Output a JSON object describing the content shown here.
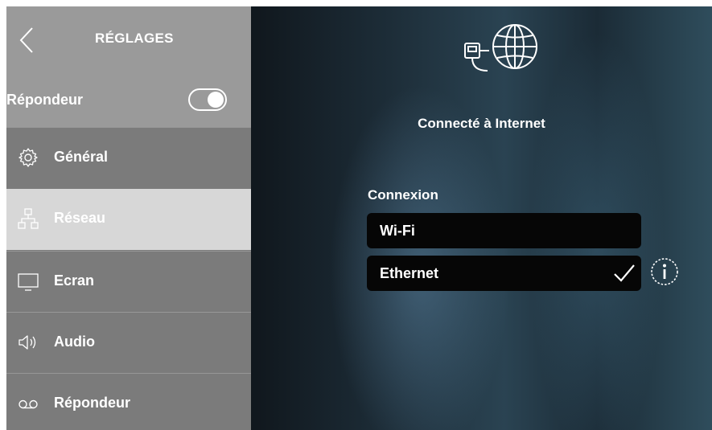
{
  "sidebar": {
    "title": "RÉGLAGES",
    "toggle_label": "Répondeur",
    "toggle_on": true,
    "items": [
      {
        "label": "Général",
        "icon": "gear-icon"
      },
      {
        "label": "Réseau",
        "icon": "network-icon",
        "active": true
      },
      {
        "label": "Ecran",
        "icon": "monitor-icon"
      },
      {
        "label": "Audio",
        "icon": "speaker-icon"
      },
      {
        "label": "Répondeur",
        "icon": "voicemail-icon"
      }
    ]
  },
  "main": {
    "status_icon": "globe-ethernet-icon",
    "status": "Connecté à Internet",
    "section_label": "Connexion",
    "options": [
      {
        "label": "Wi-Fi",
        "selected": false
      },
      {
        "label": "Ethernet",
        "selected": true
      }
    ]
  },
  "colors": {
    "sidebar_bg": "#7b7b7b",
    "sidebar_header_bg": "#9a9a9a",
    "active_item_bg": "#d7d7d7",
    "option_bg": "#060606"
  }
}
